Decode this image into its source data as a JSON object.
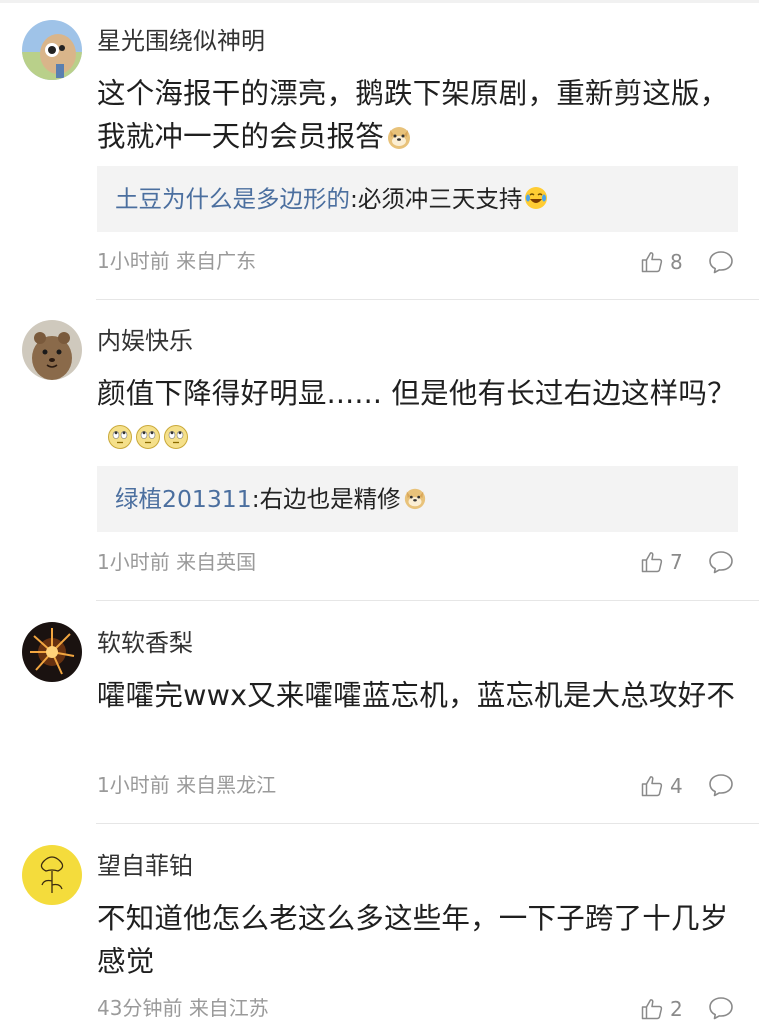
{
  "comments": [
    {
      "username": "星光围绕似神明",
      "avatar": "seal-plush-avatar",
      "content": "这个海报干的漂亮，鹅跌下架原剧，重新剪这版，我就冲一天的会员报答",
      "content_emojis": [
        "doge-emoji"
      ],
      "reply": {
        "name": "土豆为什么是多边形的",
        "text": "必须冲三天支持",
        "emoji": "laugh-cry-emoji"
      },
      "time": "1小时前",
      "location": "来自广东",
      "likes": "8"
    },
    {
      "username": "内娱快乐",
      "avatar": "quokka-avatar",
      "content": "颜值下降得好明显...... 但是他有长过右边这样吗？",
      "content_emojis": [
        "eye-roll-emoji",
        "eye-roll-emoji",
        "eye-roll-emoji"
      ],
      "reply": {
        "name": "绿植201311",
        "text": "右边也是精修",
        "emoji": "doge-emoji"
      },
      "time": "1小时前",
      "location": "来自英国",
      "likes": "7"
    },
    {
      "username": "软软香梨",
      "avatar": "fireworks-avatar",
      "content": "嚯嚯完wwx又来嚯嚯蓝忘机，蓝忘机是大总攻好不",
      "time": "1小时前",
      "location": "来自黑龙江",
      "likes": "4"
    },
    {
      "username": "望自菲铂",
      "avatar": "flower-avatar",
      "content": "不知道他怎么老这么多这些年，一下子跨了十几岁感觉",
      "time": "43分钟前",
      "location": "来自江苏",
      "likes": "2"
    }
  ]
}
